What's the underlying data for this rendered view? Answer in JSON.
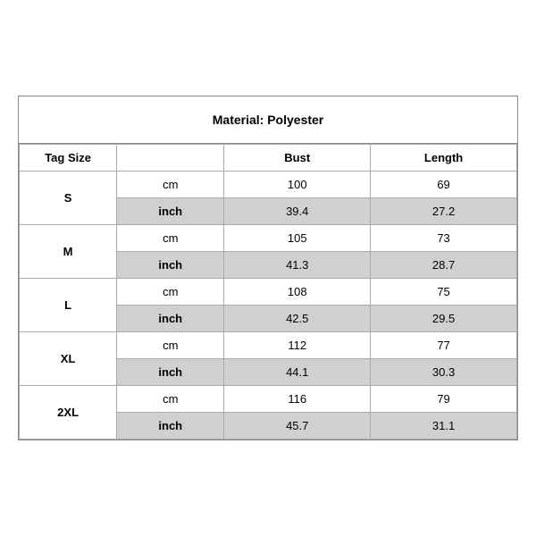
{
  "title": "Material: Polyester",
  "headers": {
    "tag_size": "Tag Size",
    "bust": "Bust",
    "length": "Length"
  },
  "rows": [
    {
      "size": "S",
      "cm": {
        "unit": "cm",
        "bust": "100",
        "length": "69"
      },
      "inch": {
        "unit": "inch",
        "bust": "39.4",
        "length": "27.2"
      }
    },
    {
      "size": "M",
      "cm": {
        "unit": "cm",
        "bust": "105",
        "length": "73"
      },
      "inch": {
        "unit": "inch",
        "bust": "41.3",
        "length": "28.7"
      }
    },
    {
      "size": "L",
      "cm": {
        "unit": "cm",
        "bust": "108",
        "length": "75"
      },
      "inch": {
        "unit": "inch",
        "bust": "42.5",
        "length": "29.5"
      }
    },
    {
      "size": "XL",
      "cm": {
        "unit": "cm",
        "bust": "112",
        "length": "77"
      },
      "inch": {
        "unit": "inch",
        "bust": "44.1",
        "length": "30.3"
      }
    },
    {
      "size": "2XL",
      "cm": {
        "unit": "cm",
        "bust": "116",
        "length": "79"
      },
      "inch": {
        "unit": "inch",
        "bust": "45.7",
        "length": "31.1"
      }
    }
  ]
}
